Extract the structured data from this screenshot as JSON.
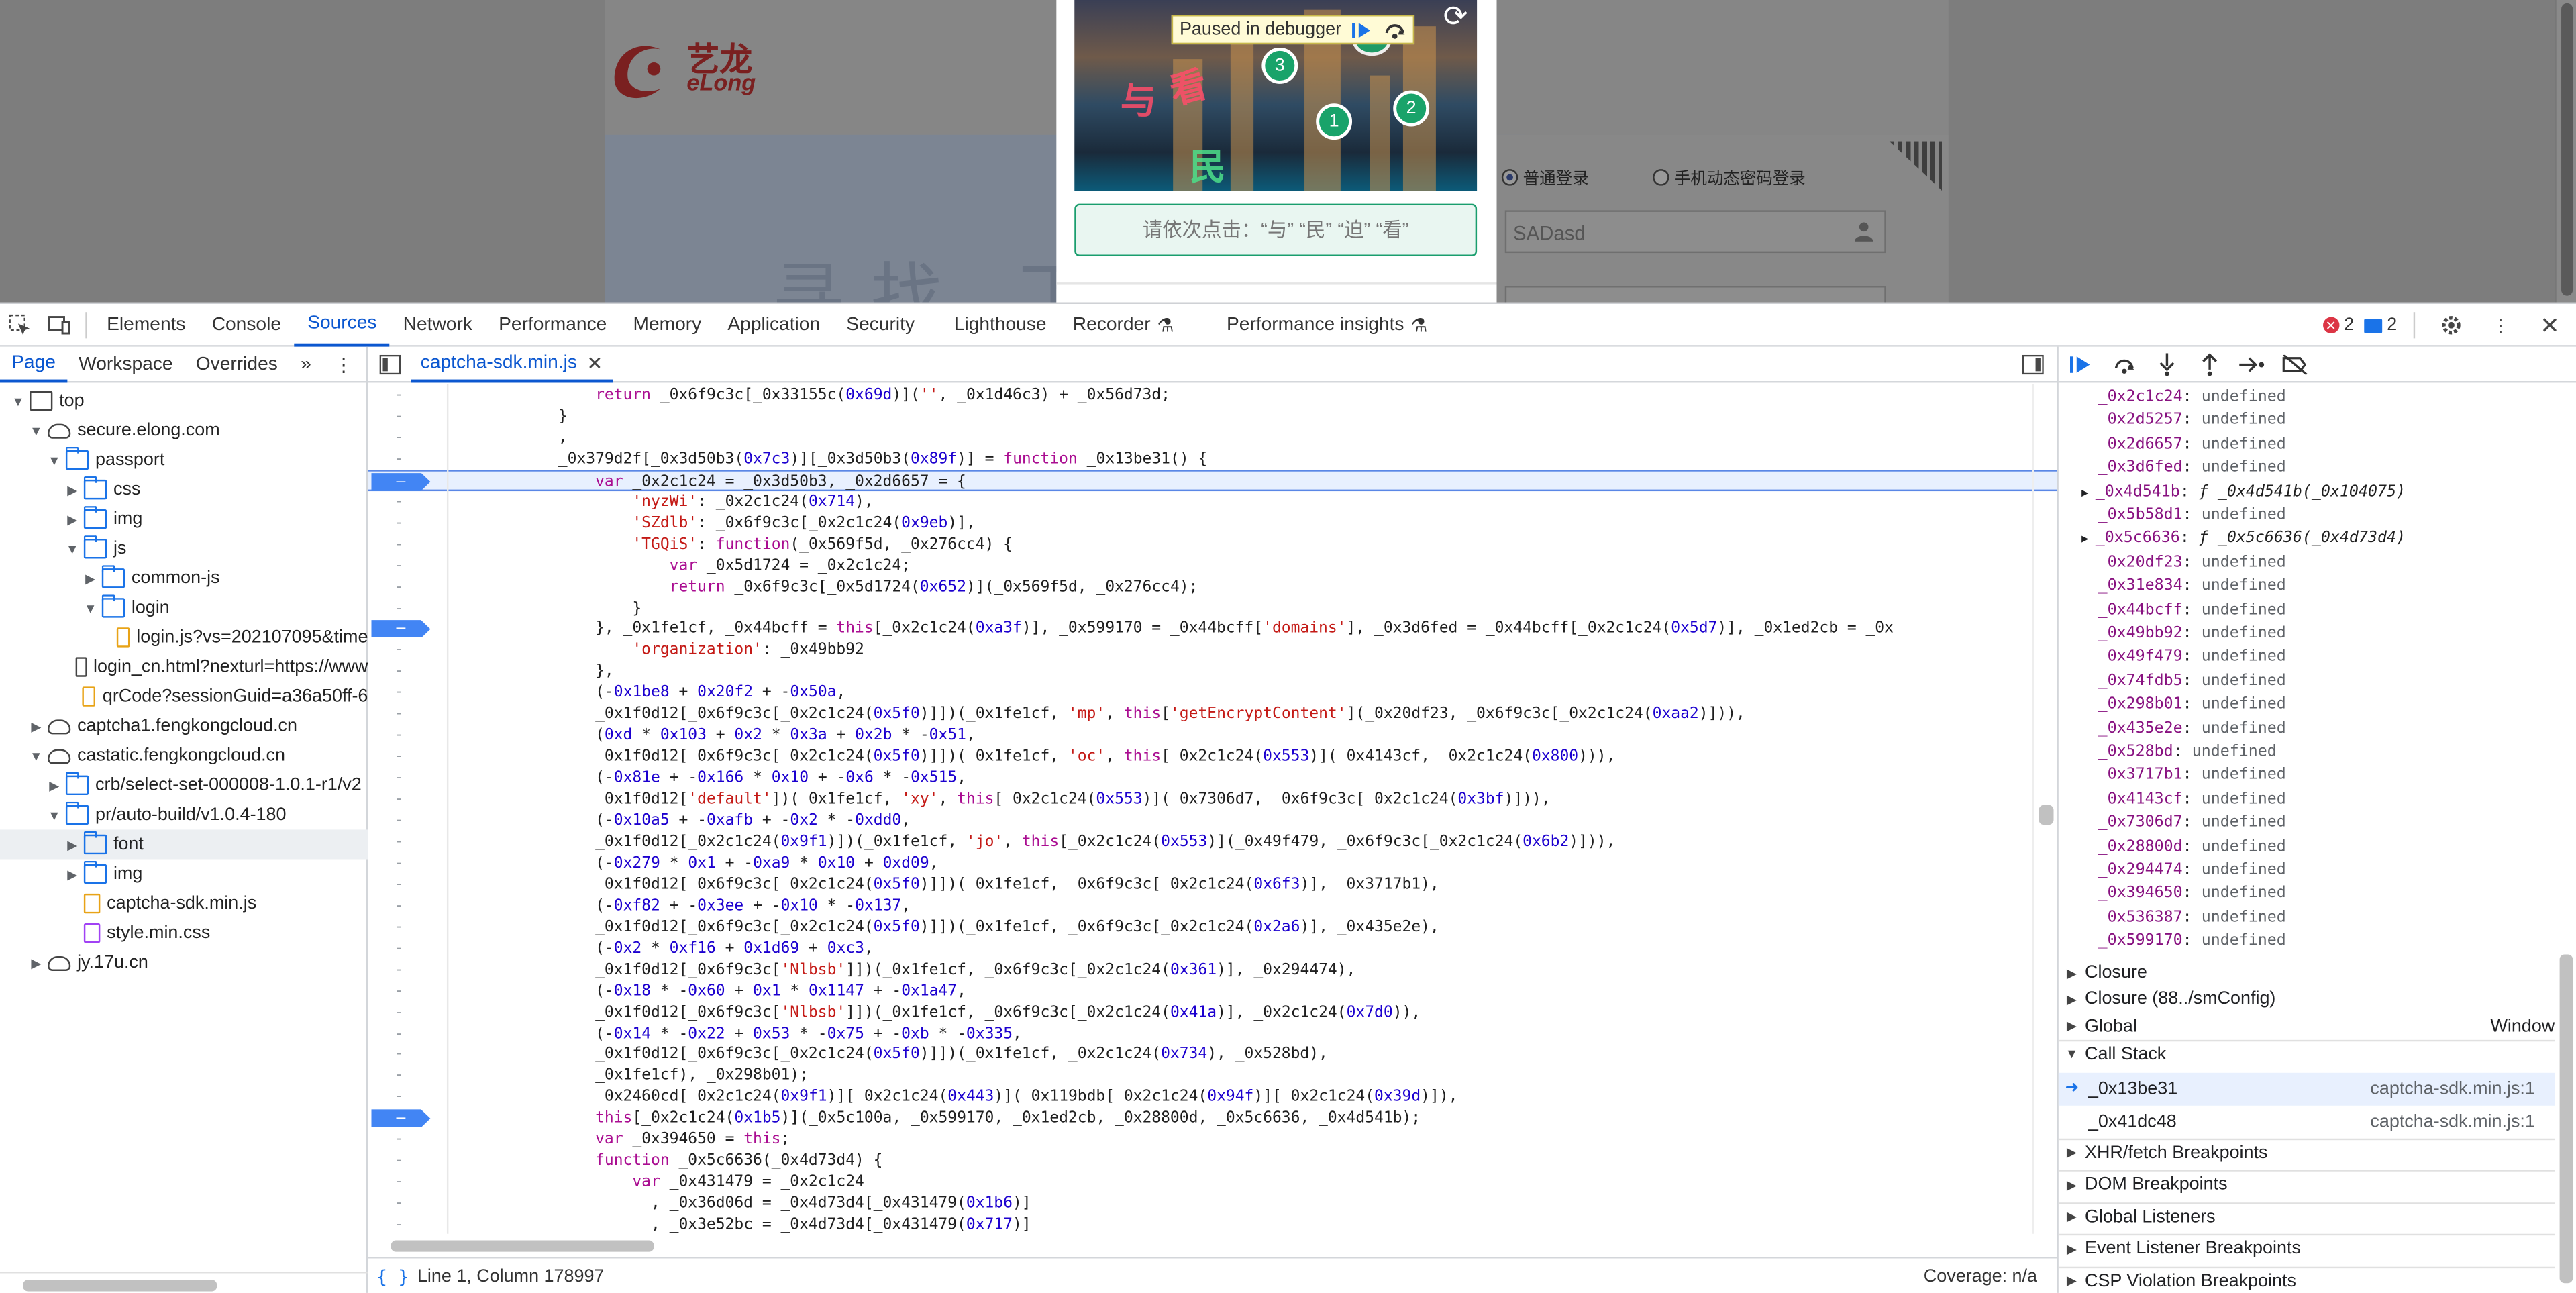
{
  "viewport": {
    "logo_text": "艺龙",
    "logo_sub": "eLong",
    "hero_text": "寻找 下",
    "radio_normal": "普通登录",
    "radio_phone": "手机动态密码登录",
    "username_value": "SADasd",
    "paused_label": "Paused in debugger",
    "captcha_prompt": "请依次点击：“与” “民” “迫” “看”",
    "captcha_markers": [
      "3",
      "1",
      "2"
    ]
  },
  "devtools": {
    "main_tabs": [
      "Elements",
      "Console",
      "Sources",
      "Network",
      "Performance",
      "Memory",
      "Application",
      "Security",
      "Lighthouse",
      "Recorder",
      "Performance insights"
    ],
    "error_count": "2",
    "message_count": "2",
    "nav_tabs": [
      "Page",
      "Workspace",
      "Overrides"
    ],
    "tree": [
      {
        "label": "top",
        "depth": 0,
        "icon": "frame",
        "tw": "▼"
      },
      {
        "label": "secure.elong.com",
        "depth": 1,
        "icon": "cloud",
        "tw": "▼"
      },
      {
        "label": "passport",
        "depth": 2,
        "icon": "folder",
        "tw": "▼"
      },
      {
        "label": "css",
        "depth": 3,
        "icon": "folder",
        "tw": "▶"
      },
      {
        "label": "img",
        "depth": 3,
        "icon": "folder",
        "tw": "▶"
      },
      {
        "label": "js",
        "depth": 3,
        "icon": "folder",
        "tw": "▼"
      },
      {
        "label": "common-js",
        "depth": 4,
        "icon": "folder",
        "tw": "▶"
      },
      {
        "label": "login",
        "depth": 4,
        "icon": "folder",
        "tw": "▼"
      },
      {
        "label": "login.js?vs=202107095&time",
        "depth": 5,
        "icon": "file-js",
        "tw": ""
      },
      {
        "label": "login_cn.html?nexturl=https://www",
        "depth": 3,
        "icon": "file-doc",
        "tw": ""
      },
      {
        "label": "qrCode?sessionGuid=a36a50ff-6",
        "depth": 3,
        "icon": "file-js",
        "tw": ""
      },
      {
        "label": "captcha1.fengkongcloud.cn",
        "depth": 1,
        "icon": "cloud",
        "tw": "▶"
      },
      {
        "label": "castatic.fengkongcloud.cn",
        "depth": 1,
        "icon": "cloud",
        "tw": "▼"
      },
      {
        "label": "crb/select-set-000008-1.0.1-r1/v2",
        "depth": 2,
        "icon": "folder",
        "tw": "▶"
      },
      {
        "label": "pr/auto-build/v1.0.4-180",
        "depth": 2,
        "icon": "folder",
        "tw": "▼"
      },
      {
        "label": "font",
        "depth": 3,
        "icon": "folder",
        "tw": "▶"
      },
      {
        "label": "img",
        "depth": 3,
        "icon": "folder",
        "tw": "▶"
      },
      {
        "label": "captcha-sdk.min.js",
        "depth": 3,
        "icon": "file-js",
        "tw": ""
      },
      {
        "label": "style.min.css",
        "depth": 3,
        "icon": "file-css",
        "tw": ""
      },
      {
        "label": "jy.17u.cn",
        "depth": 1,
        "icon": "cloud",
        "tw": "▶"
      }
    ],
    "open_file": "captcha-sdk.min.js",
    "code_lines": [
      {
        "t": "                return _0x6f9c3c[_0x33155c(0x69d)]('', _0x1d46c3) + _0x56d73d;",
        "bp": false
      },
      {
        "t": "            }",
        "bp": false
      },
      {
        "t": "            ,",
        "bp": false
      },
      {
        "t": "            _0x379d2f[_0x3d50b3(0x7c3)][_0x3d50b3(0x89f)] = function _0x13be31() {",
        "bp": false
      },
      {
        "t": "                var _0x2c1c24 = _0x3d50b3, _0x2d6657 = {",
        "bp": true,
        "exec": true
      },
      {
        "t": "                    'nyzWi': _0x2c1c24(0x714),",
        "bp": false
      },
      {
        "t": "                    'SZdlb': _0x6f9c3c[_0x2c1c24(0x9eb)],",
        "bp": false
      },
      {
        "t": "                    'TGQiS': function(_0x569f5d, _0x276cc4) {",
        "bp": false
      },
      {
        "t": "                        var _0x5d1724 = _0x2c1c24;",
        "bp": false
      },
      {
        "t": "                        return _0x6f9c3c[_0x5d1724(0x652)](_0x569f5d, _0x276cc4);",
        "bp": false
      },
      {
        "t": "                    }",
        "bp": false
      },
      {
        "t": "                }, _0x1fe1cf, _0x44bcff = this[_0x2c1c24(0xa3f)], _0x599170 = _0x44bcff['domains'], _0x3d6fed = _0x44bcff[_0x2c1c24(0x5d7)], _0x1ed2cb = _0x",
        "bp": true
      },
      {
        "t": "                    'organization': _0x49bb92",
        "bp": false
      },
      {
        "t": "                },",
        "bp": false
      },
      {
        "t": "                (-0x1be8 + 0x20f2 + -0x50a,",
        "bp": false
      },
      {
        "t": "                _0x1f0d12[_0x6f9c3c[_0x2c1c24(0x5f0)]])(_0x1fe1cf, 'mp', this['getEncryptContent'](_0x20df23, _0x6f9c3c[_0x2c1c24(0xaa2)])),",
        "bp": false
      },
      {
        "t": "                (0xd * 0x103 + 0x2 * 0x3a + 0x2b * -0x51,",
        "bp": false
      },
      {
        "t": "                _0x1f0d12[_0x6f9c3c[_0x2c1c24(0x5f0)]])(_0x1fe1cf, 'oc', this[_0x2c1c24(0x553)](_0x4143cf, _0x2c1c24(0x800))),",
        "bp": false
      },
      {
        "t": "                (-0x81e + -0x166 * 0x10 + -0x6 * -0x515,",
        "bp": false
      },
      {
        "t": "                _0x1f0d12['default'])(_0x1fe1cf, 'xy', this[_0x2c1c24(0x553)](_0x7306d7, _0x6f9c3c[_0x2c1c24(0x3bf)])),",
        "bp": false
      },
      {
        "t": "                (-0x10a5 + -0xafb + -0x2 * -0xdd0,",
        "bp": false
      },
      {
        "t": "                _0x1f0d12[_0x2c1c24(0x9f1)])(_0x1fe1cf, 'jo', this[_0x2c1c24(0x553)](_0x49f479, _0x6f9c3c[_0x2c1c24(0x6b2)])),",
        "bp": false
      },
      {
        "t": "                (-0x279 * 0x1 + -0xa9 * 0x10 + 0xd09,",
        "bp": false
      },
      {
        "t": "                _0x1f0d12[_0x6f9c3c[_0x2c1c24(0x5f0)]])(_0x1fe1cf, _0x6f9c3c[_0x2c1c24(0x6f3)], _0x3717b1),",
        "bp": false
      },
      {
        "t": "                (-0xf82 + -0x3ee + -0x10 * -0x137,",
        "bp": false
      },
      {
        "t": "                _0x1f0d12[_0x6f9c3c[_0x2c1c24(0x5f0)]])(_0x1fe1cf, _0x6f9c3c[_0x2c1c24(0x2a6)], _0x435e2e),",
        "bp": false
      },
      {
        "t": "                (-0x2 * 0xf16 + 0x1d69 + 0xc3,",
        "bp": false
      },
      {
        "t": "                _0x1f0d12[_0x6f9c3c['Nlbsb']])(_0x1fe1cf, _0x6f9c3c[_0x2c1c24(0x361)], _0x294474),",
        "bp": false
      },
      {
        "t": "                (-0x18 * -0x60 + 0x1 * 0x1147 + -0x1a47,",
        "bp": false
      },
      {
        "t": "                _0x1f0d12[_0x6f9c3c['Nlbsb']])(_0x1fe1cf, _0x6f9c3c[_0x2c1c24(0x41a)], _0x2c1c24(0x7d0)),",
        "bp": false
      },
      {
        "t": "                (-0x14 * -0x22 + 0x53 * -0x75 + -0xb * -0x335,",
        "bp": false
      },
      {
        "t": "                _0x1f0d12[_0x6f9c3c[_0x2c1c24(0x5f0)]])(_0x1fe1cf, _0x2c1c24(0x734), _0x528bd),",
        "bp": false
      },
      {
        "t": "                _0x1fe1cf), _0x298b01);",
        "bp": false
      },
      {
        "t": "                _0x2460cd[_0x2c1c24(0x9f1)][_0x2c1c24(0x443)](_0x119bdb[_0x2c1c24(0x94f)][_0x2c1c24(0x39d)]),",
        "bp": false
      },
      {
        "t": "                this[_0x2c1c24(0x1b5)](_0x5c100a, _0x599170, _0x1ed2cb, _0x28800d, _0x5c6636, _0x4d541b);",
        "bp": true
      },
      {
        "t": "                var _0x394650 = this;",
        "bp": false
      },
      {
        "t": "                function _0x5c6636(_0x4d73d4) {",
        "bp": false
      },
      {
        "t": "                    var _0x431479 = _0x2c1c24",
        "bp": false
      },
      {
        "t": "                      , _0x36d06d = _0x4d73d4[_0x431479(0x1b6)]",
        "bp": false
      },
      {
        "t": "                      , _0x3e52bc = _0x4d73d4[_0x431479(0x717)]",
        "bp": false
      }
    ],
    "status_position": "Line 1, Column 178997",
    "status_coverage": "Coverage: n/a",
    "scope_vars": [
      {
        "k": "_0x2c1c24",
        "v": "undefined"
      },
      {
        "k": "_0x2d5257",
        "v": "undefined"
      },
      {
        "k": "_0x2d6657",
        "v": "undefined"
      },
      {
        "k": "_0x3d6fed",
        "v": "undefined"
      },
      {
        "k": "_0x4d541b",
        "v": "ƒ _0x4d541b(_0x104075)",
        "fn": true
      },
      {
        "k": "_0x5b58d1",
        "v": "undefined"
      },
      {
        "k": "_0x5c6636",
        "v": "ƒ _0x5c6636(_0x4d73d4)",
        "fn": true
      },
      {
        "k": "_0x20df23",
        "v": "undefined"
      },
      {
        "k": "_0x31e834",
        "v": "undefined"
      },
      {
        "k": "_0x44bcff",
        "v": "undefined"
      },
      {
        "k": "_0x49bb92",
        "v": "undefined"
      },
      {
        "k": "_0x49f479",
        "v": "undefined"
      },
      {
        "k": "_0x74fdb5",
        "v": "undefined"
      },
      {
        "k": "_0x298b01",
        "v": "undefined"
      },
      {
        "k": "_0x435e2e",
        "v": "undefined"
      },
      {
        "k": "_0x528bd",
        "v": "undefined"
      },
      {
        "k": "_0x3717b1",
        "v": "undefined"
      },
      {
        "k": "_0x4143cf",
        "v": "undefined"
      },
      {
        "k": "_0x7306d7",
        "v": "undefined"
      },
      {
        "k": "_0x28800d",
        "v": "undefined"
      },
      {
        "k": "_0x294474",
        "v": "undefined"
      },
      {
        "k": "_0x394650",
        "v": "undefined"
      },
      {
        "k": "_0x536387",
        "v": "undefined"
      },
      {
        "k": "_0x599170",
        "v": "undefined"
      }
    ],
    "scope_sections": [
      {
        "label": "Closure",
        "right": ""
      },
      {
        "label": "Closure (88../smConfig)",
        "right": ""
      },
      {
        "label": "Global",
        "right": "Window"
      }
    ],
    "call_stack_title": "Call Stack",
    "call_stack": [
      {
        "name": "_0x13be31",
        "loc": "captcha-sdk.min.js:1",
        "active": true
      },
      {
        "name": "_0x41dc48",
        "loc": "captcha-sdk.min.js:1",
        "active": false
      }
    ],
    "bottom_sections": [
      "XHR/fetch Breakpoints",
      "DOM Breakpoints",
      "Global Listeners",
      "Event Listener Breakpoints",
      "CSP Violation Breakpoints"
    ]
  }
}
